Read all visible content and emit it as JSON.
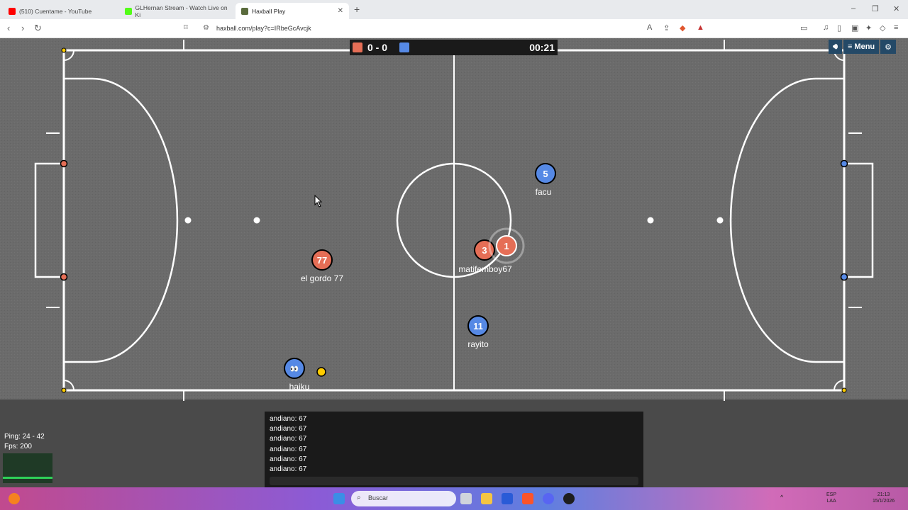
{
  "browser": {
    "tabs": [
      {
        "title": "(510) Cuentame - YouTube",
        "favicon_color": "#ff0000"
      },
      {
        "title": "GLHernan Stream - Watch Live on Ki",
        "favicon_color": "#53fc18"
      },
      {
        "title": "Haxball Play",
        "favicon_color": "#5a6b3c"
      }
    ],
    "new_tab_symbol": "+",
    "url": "haxball.com/play?c=IRbeGcAvcjk"
  },
  "game": {
    "score_red": "0",
    "score_separator": "-",
    "score_blue": "0",
    "score_text": "0 - 0",
    "timer": "00:21",
    "menu_label": "Menu",
    "players": [
      {
        "number": "77",
        "name": "el gordo 77",
        "team": "red"
      },
      {
        "number": "3",
        "name": "matifemboy67",
        "team": "red"
      },
      {
        "number": "1",
        "name": "",
        "team": "red"
      },
      {
        "number": "5",
        "name": "facu",
        "team": "blue"
      },
      {
        "number": "11",
        "name": "rayito",
        "team": "blue"
      },
      {
        "number": "👀",
        "name": "haiku",
        "team": "blue"
      }
    ],
    "team_colors": {
      "red": "#e56e56",
      "blue": "#5689e5",
      "ball": "#ffcc00",
      "pitch": "#6b6b6b"
    },
    "stats": {
      "ping": "Ping: 24 - 42",
      "fps": "Fps: 200"
    },
    "chat": [
      "andiano: 67",
      "andiano: 67",
      "andiano: 67",
      "andiano: 67",
      "andiano: 67",
      "andiano: 67"
    ]
  },
  "taskbar": {
    "search_placeholder": "Buscar",
    "lang": "ESP",
    "lang2": "LAA",
    "time": "21:13",
    "date": "15/1/2026"
  }
}
